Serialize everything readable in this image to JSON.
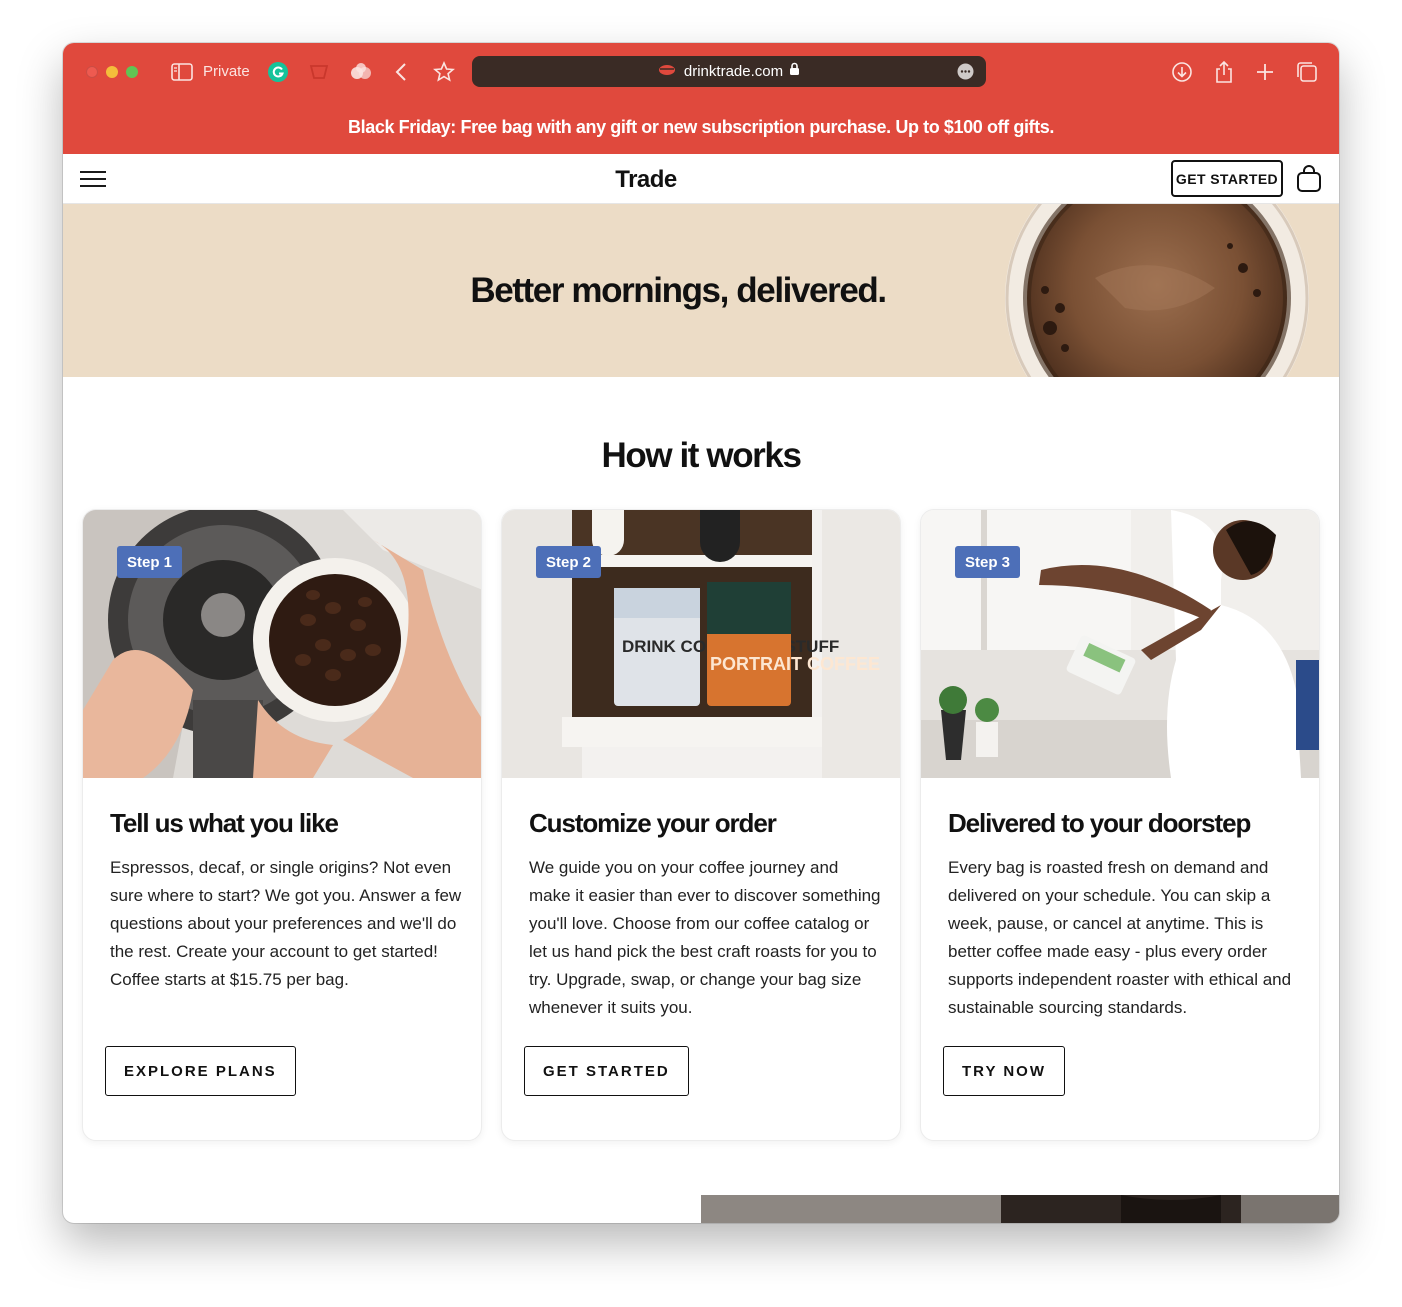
{
  "browser": {
    "mode_label": "Private",
    "url": "drinktrade.com",
    "colors": {
      "toolbar": "#e0493d",
      "urlbar": "#3a2b25"
    }
  },
  "promo": {
    "text": "Black Friday: Free bag with any gift or new subscription purchase. Up to $100 off gifts."
  },
  "header": {
    "logo": "Trade",
    "cta_label": "GET STARTED"
  },
  "hero": {
    "headline": "Better mornings, delivered."
  },
  "how_it_works": {
    "title": "How it works",
    "steps": [
      {
        "badge": "Step 1",
        "title": "Tell us what you like",
        "text": "Espressos, decaf, or single origins? Not even sure where to start? We got you. Answer a few questions about your preferences and we'll do the rest. Create your account to get started! Coffee starts at $15.75 per bag.",
        "button": "EXPLORE PLANS"
      },
      {
        "badge": "Step 2",
        "title": "Customize your order",
        "text": "We guide you on your coffee journey and make it easier than ever to discover something you'll love. Choose from our coffee catalog or let us hand pick the best craft roasts for you to try. Upgrade, swap, or change your bag size whenever it suits you.",
        "button": "GET STARTED",
        "bag_labels": [
          "DRINK COFFEE DO STUFF",
          "PORTRAIT COFFEE"
        ]
      },
      {
        "badge": "Step 3",
        "title": "Delivered to your doorstep",
        "text": "Every bag is roasted fresh on demand and delivered on your schedule. You can skip a week, pause, or cancel at anytime. This is better coffee made easy - plus every order supports independent roaster with ethical and sustainable sourcing standards.",
        "button": "TRY NOW"
      }
    ]
  },
  "colors": {
    "brand_red": "#e0493d",
    "hero_bg": "#ecdcc6",
    "badge": "#4d6fb8"
  }
}
